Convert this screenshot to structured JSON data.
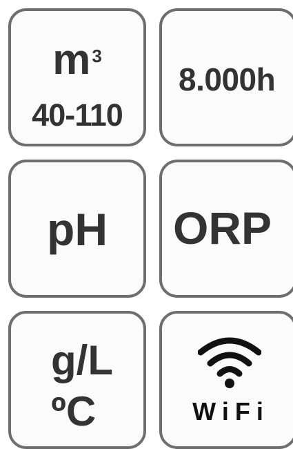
{
  "tiles": {
    "volume": {
      "unit": "m",
      "unit_exponent": "3",
      "range": "40-110"
    },
    "hours": {
      "label": "8.000h"
    },
    "ph": {
      "label": "pH"
    },
    "orp": {
      "label": "ORP"
    },
    "salinity_temp": {
      "salinity": "g/L",
      "temperature": "ºC"
    },
    "wifi": {
      "label": "WiFi",
      "icon": "wifi-icon"
    }
  },
  "colors": {
    "border": "#6e6e6e",
    "text": "#333333",
    "background": "#fbfbfb"
  }
}
